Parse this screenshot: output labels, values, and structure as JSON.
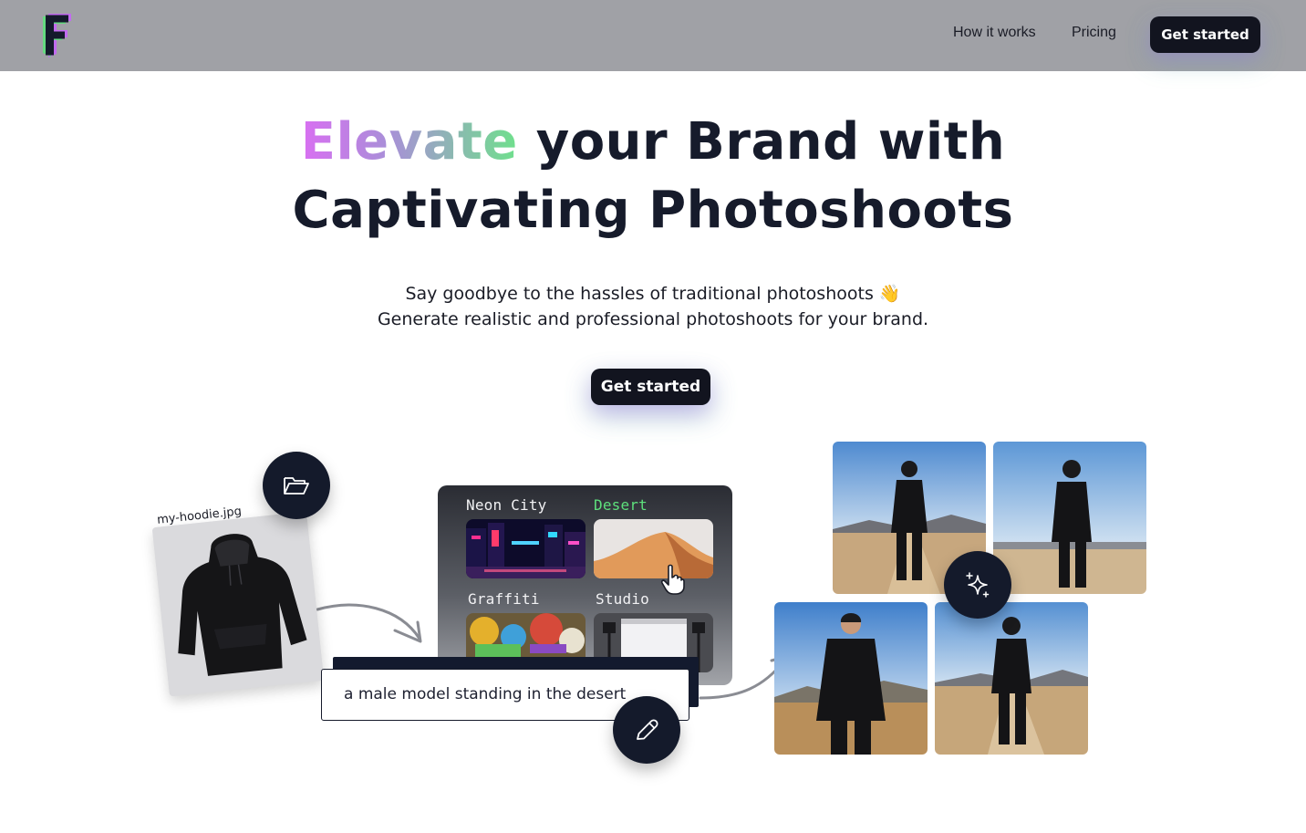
{
  "header": {
    "logo_icon": "f-logo-icon",
    "nav": [
      {
        "label": "How it works"
      },
      {
        "label": "Pricing"
      }
    ],
    "cta_label": "Get started"
  },
  "hero": {
    "title_highlight": "Elevate",
    "title_rest_line1": " your Brand with",
    "title_line2": "Captivating Photoshoots",
    "subtitle_line1": "Say goodbye to the hassles of traditional photoshoots 👋",
    "subtitle_line2": "Generate realistic and professional photoshoots for your brand.",
    "cta_label": "Get started"
  },
  "upload": {
    "filename": "my-hoodie.jpg",
    "icon": "folder-open-icon"
  },
  "styles": {
    "items": [
      {
        "label": "Neon City",
        "active": false
      },
      {
        "label": "Desert",
        "active": true
      },
      {
        "label": "Graffiti",
        "active": false
      },
      {
        "label": "Studio",
        "active": false
      }
    ],
    "active_color": "#5ee07c"
  },
  "prompt": {
    "value": "a male model standing in the desert",
    "edit_icon": "pencil-icon"
  },
  "results": {
    "generate_icon": "sparkle-icon",
    "count": 4
  },
  "colors": {
    "header_bg": "#a0a1a6",
    "dark": "#12141f",
    "gradient_start": "#d96ff2",
    "gradient_end": "#6fe08c"
  }
}
